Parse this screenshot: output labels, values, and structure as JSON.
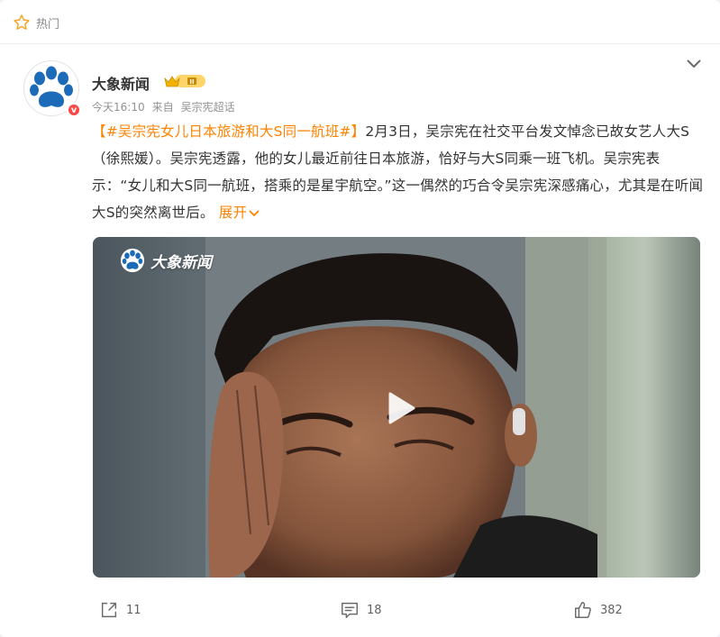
{
  "header": {
    "hot_label": "热门"
  },
  "post": {
    "author": {
      "name": "大象新闻"
    },
    "meta": {
      "time": "今天16:10",
      "from_label": "来自",
      "source": "吴宗宪超话"
    },
    "text": {
      "tag": "【#吴宗宪女儿日本旅游和大S同一航班#】",
      "body": "2月3日，吴宗宪在社交平台发文悼念已故女艺人大S（徐熙媛）。吴宗宪透露，他的女儿最近前往日本旅游，恰好与大S同乘一班飞机。吴宗宪表示：“女儿和大S同一航班，搭乘的是星宇航空。”这一偶然的巧合令吴宗宪深感痛心，尤其是在听闻大S的突然离世后。",
      "expand_label": "展开"
    },
    "video": {
      "watermark": "大象新闻"
    },
    "actions": {
      "share_count": "11",
      "comment_count": "18",
      "like_count": "382"
    }
  },
  "colors": {
    "accent": "#ff8200",
    "badge_red": "#ff4545",
    "text": "#333333",
    "meta": "#939393"
  },
  "icons": {
    "hot": "star-icon",
    "collapse": "chevron-down-icon",
    "share": "share-icon",
    "comment": "comment-icon",
    "like": "thumbs-up-icon",
    "play": "play-icon",
    "verified": "verified-badge-icon"
  }
}
